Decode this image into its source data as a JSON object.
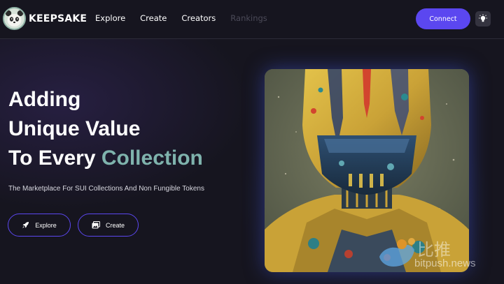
{
  "brand": {
    "name": "KEEPSAKE",
    "logo_icon": "panda-icon"
  },
  "nav": [
    {
      "label": "Explore",
      "state": "active"
    },
    {
      "label": "Create",
      "state": "active"
    },
    {
      "label": "Creators",
      "state": "active"
    },
    {
      "label": "Rankings",
      "state": "disabled"
    }
  ],
  "header": {
    "connect_label": "Connect",
    "theme_icon": "lightbulb-icon"
  },
  "hero": {
    "line1": "Adding",
    "line2": "Unique Value",
    "line3_prefix": "To Every ",
    "line3_accent": "Collection",
    "subtitle": "The Marketplace For SUI Collections And Non Fungible Tokens",
    "explore_label": "Explore",
    "create_label": "Create"
  },
  "featured": {
    "artwork": "astronaut-helmet-painting"
  },
  "watermark": {
    "chinese": "比推",
    "domain": "bitpush.news"
  },
  "colors": {
    "background": "#16151f",
    "accent": "#5b47f0",
    "highlight_text": "#7fb3ad",
    "disabled_text": "#4b4a58"
  }
}
